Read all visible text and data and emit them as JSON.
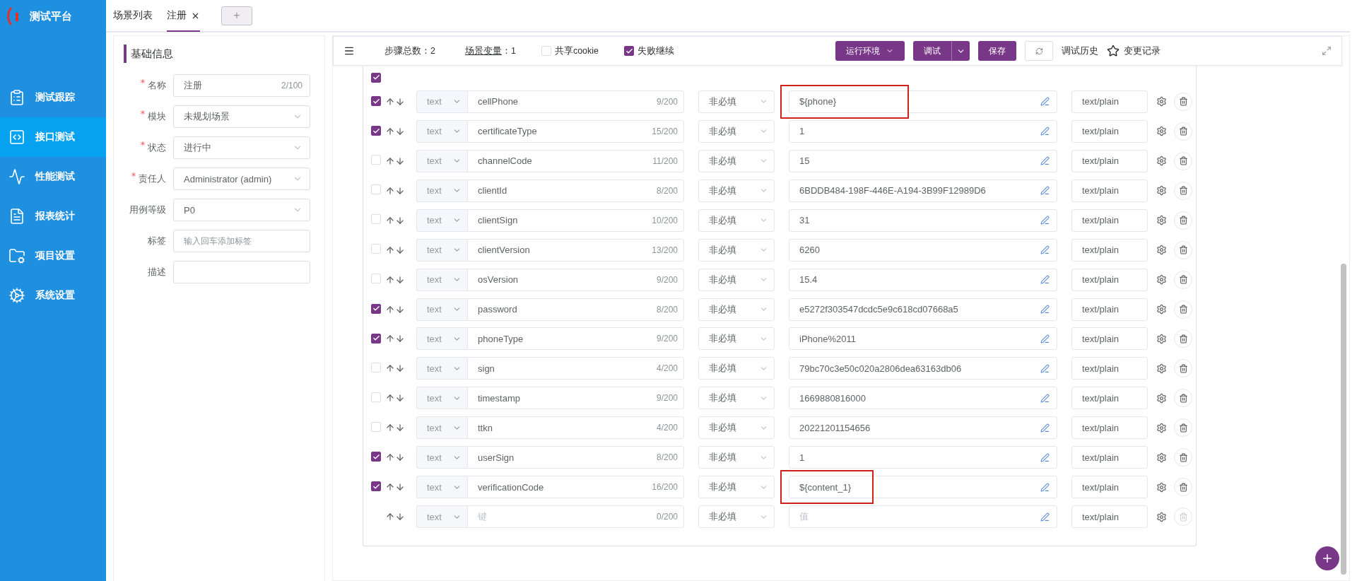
{
  "app": {
    "logo": "测试平台"
  },
  "nav": [
    {
      "label": "测试跟踪",
      "selected": false
    },
    {
      "label": "接口测试",
      "selected": true
    },
    {
      "label": "性能测试",
      "selected": false
    },
    {
      "label": "报表统计",
      "selected": false
    },
    {
      "label": "项目设置",
      "selected": false
    },
    {
      "label": "系统设置",
      "selected": false
    }
  ],
  "tabs": [
    {
      "label": "场景列表",
      "selected": false,
      "closable": false
    },
    {
      "label": "注册",
      "selected": true,
      "closable": true
    }
  ],
  "add_tab": "+",
  "basic": {
    "title": "基础信息",
    "fields": [
      {
        "label": "名称",
        "required": true,
        "kind": "input",
        "value": "注册",
        "count": "2/100"
      },
      {
        "label": "模块",
        "required": true,
        "kind": "select",
        "value": "未规划场景"
      },
      {
        "label": "状态",
        "required": true,
        "kind": "select",
        "value": "进行中"
      },
      {
        "label": "责任人",
        "required": true,
        "kind": "select",
        "value": "Administrator (admin)"
      },
      {
        "label": "用例等级",
        "required": false,
        "kind": "select",
        "value": "P0"
      },
      {
        "label": "标签",
        "required": false,
        "kind": "tags",
        "placeholder": "输入回车添加标签"
      },
      {
        "label": "描述",
        "required": false,
        "kind": "textarea"
      }
    ]
  },
  "toolbar": {
    "steps_label": "步骤总数：",
    "steps_value": "2",
    "vars_link": "场景变量",
    "vars_value": "：1",
    "options": [
      {
        "label": "共享cookie",
        "checked": false
      },
      {
        "label": "失败继续",
        "checked": true
      }
    ],
    "env_button": "运行环境",
    "debug_button": "调试",
    "save_button": "保存",
    "history_link": "调试历史",
    "changes_link": "变更记录"
  },
  "params": {
    "all_checked": true,
    "rows": [
      {
        "checked": true,
        "type": "text",
        "key": "cellPhone",
        "count": "9/200",
        "required": "非必填",
        "value": "${phone}",
        "highlighted": true,
        "content_type": "text/plain"
      },
      {
        "checked": true,
        "type": "text",
        "key": "certificateType",
        "count": "15/200",
        "required": "非必填",
        "value": "1",
        "highlighted": false,
        "content_type": "text/plain"
      },
      {
        "checked": false,
        "type": "text",
        "key": "channelCode",
        "count": "11/200",
        "required": "非必填",
        "value": "15",
        "highlighted": false,
        "content_type": "text/plain"
      },
      {
        "checked": false,
        "type": "text",
        "key": "clientId",
        "count": "8/200",
        "required": "非必填",
        "value": "6BDDB484-198F-446E-A194-3B99F12989D6",
        "highlighted": false,
        "content_type": "text/plain"
      },
      {
        "checked": false,
        "type": "text",
        "key": "clientSign",
        "count": "10/200",
        "required": "非必填",
        "value": "31",
        "highlighted": false,
        "content_type": "text/plain"
      },
      {
        "checked": false,
        "type": "text",
        "key": "clientVersion",
        "count": "13/200",
        "required": "非必填",
        "value": "6260",
        "highlighted": false,
        "content_type": "text/plain"
      },
      {
        "checked": false,
        "type": "text",
        "key": "osVersion",
        "count": "9/200",
        "required": "非必填",
        "value": "15.4",
        "highlighted": false,
        "content_type": "text/plain"
      },
      {
        "checked": true,
        "type": "text",
        "key": "password",
        "count": "8/200",
        "required": "非必填",
        "value": "e5272f303547dcdc5e9c618cd07668a5",
        "highlighted": false,
        "content_type": "text/plain"
      },
      {
        "checked": true,
        "type": "text",
        "key": "phoneType",
        "count": "9/200",
        "required": "非必填",
        "value": "iPhone%2011",
        "highlighted": false,
        "content_type": "text/plain"
      },
      {
        "checked": false,
        "type": "text",
        "key": "sign",
        "count": "4/200",
        "required": "非必填",
        "value": "79bc70c3e50c020a2806dea63163db06",
        "highlighted": false,
        "content_type": "text/plain"
      },
      {
        "checked": false,
        "type": "text",
        "key": "timestamp",
        "count": "9/200",
        "required": "非必填",
        "value": "1669880816000",
        "highlighted": false,
        "content_type": "text/plain"
      },
      {
        "checked": false,
        "type": "text",
        "key": "ttkn",
        "count": "4/200",
        "required": "非必填",
        "value": "20221201154656",
        "highlighted": false,
        "content_type": "text/plain"
      },
      {
        "checked": true,
        "type": "text",
        "key": "userSign",
        "count": "8/200",
        "required": "非必填",
        "value": "1",
        "highlighted": false,
        "content_type": "text/plain"
      },
      {
        "checked": true,
        "type": "text",
        "key": "verificationCode",
        "count": "16/200",
        "required": "非必填",
        "value": "${content_1}",
        "highlighted": true,
        "content_type": "text/plain"
      }
    ],
    "new_row": {
      "type": "text",
      "key_placeholder": "键",
      "count": "0/200",
      "required": "非必填",
      "value_placeholder": "值",
      "content_type": "text/plain"
    }
  }
}
